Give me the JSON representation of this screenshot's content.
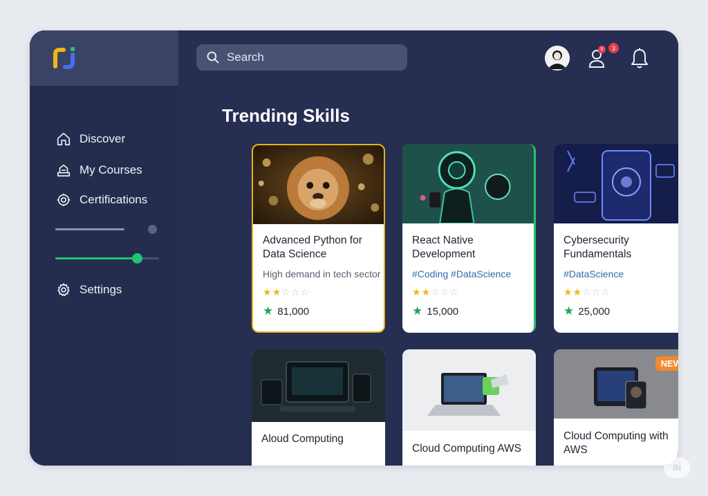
{
  "search": {
    "placeholder": "Search"
  },
  "header": {
    "friend_badge_1": "9",
    "friend_badge_2": "3"
  },
  "sidebar": {
    "items": [
      {
        "label": "Discover",
        "icon": "home-icon"
      },
      {
        "label": "My Courses",
        "icon": "courses-icon"
      },
      {
        "label": "Certifications",
        "icon": "certification-icon"
      },
      {
        "label": "Settings",
        "icon": "gear-icon"
      }
    ],
    "sliders": [
      {
        "value_fraction": 1.0,
        "color": "#8e94ab"
      },
      {
        "value_fraction": 0.78,
        "color": "#24c46f"
      }
    ]
  },
  "main": {
    "title": "Trending Skills",
    "cards": [
      {
        "title": "Advanced Python for Data Science",
        "subtitle": "High demand in tech sector",
        "rating": 2,
        "count": "81,000"
      },
      {
        "title": "React Native Development",
        "tags": "#Coding #DataScience",
        "rating": 2,
        "count": "15,000"
      },
      {
        "title": "Cybersecurity Fundamentals",
        "tags": "#DataScience",
        "rating": 2,
        "count": "25,000"
      },
      {
        "title": "Aloud Computing"
      },
      {
        "title": "Cloud Computing AWS"
      },
      {
        "title": "Cloud Computing with AWS",
        "badge": "NEW"
      }
    ]
  },
  "watermark": "ai",
  "colors": {
    "accent_green": "#24c46f",
    "star_gold": "#f2b613",
    "badge_red": "#e53d4a",
    "new_orange": "#f08a2a"
  }
}
